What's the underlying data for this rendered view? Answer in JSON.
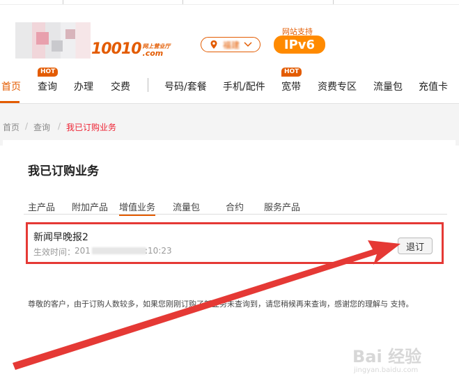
{
  "brand": {
    "number": "10010",
    "cn_tagline": "网上营业厅",
    "com": ".com"
  },
  "city": {
    "name": "福建"
  },
  "ipv6": {
    "label": "网站支持",
    "badge": "IPv6"
  },
  "nav": {
    "items": [
      "首页",
      "查询",
      "办理",
      "交费",
      "号码/套餐",
      "手机/配件",
      "宽带",
      "资费专区",
      "流量包",
      "充值卡"
    ],
    "hot_label": "HOT"
  },
  "breadcrumb": {
    "home": "首页",
    "query": "查询",
    "current": "我已订购业务",
    "sep": "/"
  },
  "page": {
    "title": "我已订购业务",
    "tabs": [
      "主产品",
      "附加产品",
      "增值业务",
      "流量包",
      "合约",
      "服务产品"
    ],
    "active_tab": "增值业务"
  },
  "subscription": {
    "name": "新闻早晚报2",
    "time_label": "生效时间：",
    "time_prefix": "201",
    "time_suffix": ":10:23",
    "button": "退订"
  },
  "notice": "尊敬的客户，由于订购人数较多，如果您刚刚订购了新业务未查询到，请您稍候再来查询，感谢您的理解与 支持。",
  "watermark": {
    "text": "Bai 经验",
    "url": "jingyan.baidu.com"
  },
  "colors": {
    "accent": "#e35b00",
    "highlight": "#e53935",
    "ipv6": "#ff8a00"
  }
}
